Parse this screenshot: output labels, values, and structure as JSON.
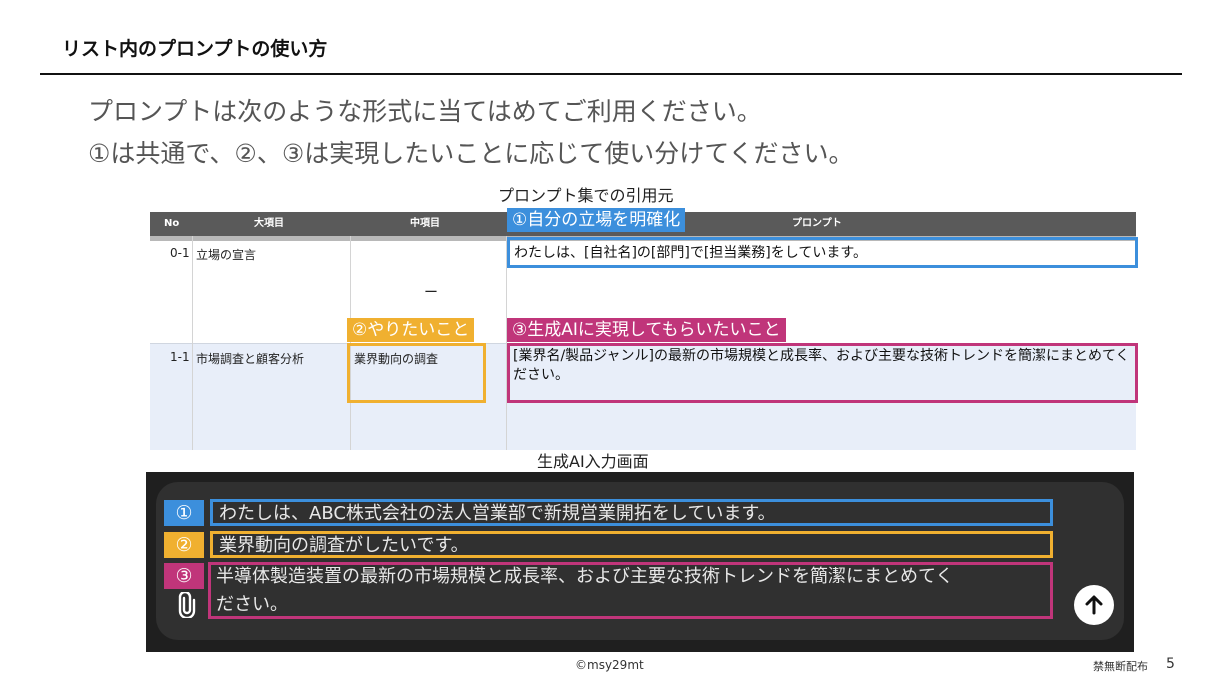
{
  "header": {
    "title": "リスト内のプロンプトの使い方"
  },
  "intro": {
    "line1": "プロンプトは次のような形式に当てはめてご利用ください。",
    "line2": "①は共通で、②、③は実現したいことに応じて使い分けてください。"
  },
  "captions": {
    "table": "プロンプト集での引用元",
    "input": "生成AI入力画面"
  },
  "table": {
    "headers": [
      "No",
      "大項目",
      "中項目",
      "プロンプト"
    ],
    "rows": [
      {
        "no": "0-1",
        "category": "立場の宣言",
        "subcategory": "ー",
        "prompt": "わたしは、[自社名]の[部門]で[担当業務]をしています。"
      },
      {
        "no": "1-1",
        "category": "市場調査と顧客分析",
        "subcategory": "業界動向の調査",
        "prompt": "[業界名/製品ジャンル]の最新の市場規模と成長率、および主要な技術トレンドを簡潔にまとめてください。"
      }
    ]
  },
  "tags": {
    "one": "①自分の立場を明確化",
    "two": "②やりたいこと",
    "three": "③生成AIに実現してもらいたいこと"
  },
  "ai_input": {
    "badges": [
      "①",
      "②",
      "③"
    ],
    "line1": "わたしは、ABC株式会社の法人営業部で新規営業開拓をしています。",
    "line2": "業界動向の調査がしたいです。",
    "line3a": "半導体製造装置の最新の市場規模と成長率、および主要な技術トレンドを簡潔にまとめてく",
    "line3b": "ださい。"
  },
  "icons": {
    "attach": "paperclip-icon",
    "send": "arrow-up-icon"
  },
  "colors": {
    "blue": "#3c8fdc",
    "yellow": "#f0b030",
    "pink": "#c0357a"
  },
  "footer": {
    "copyright": "©msy29mt",
    "note": "禁無断配布",
    "page": "5"
  }
}
